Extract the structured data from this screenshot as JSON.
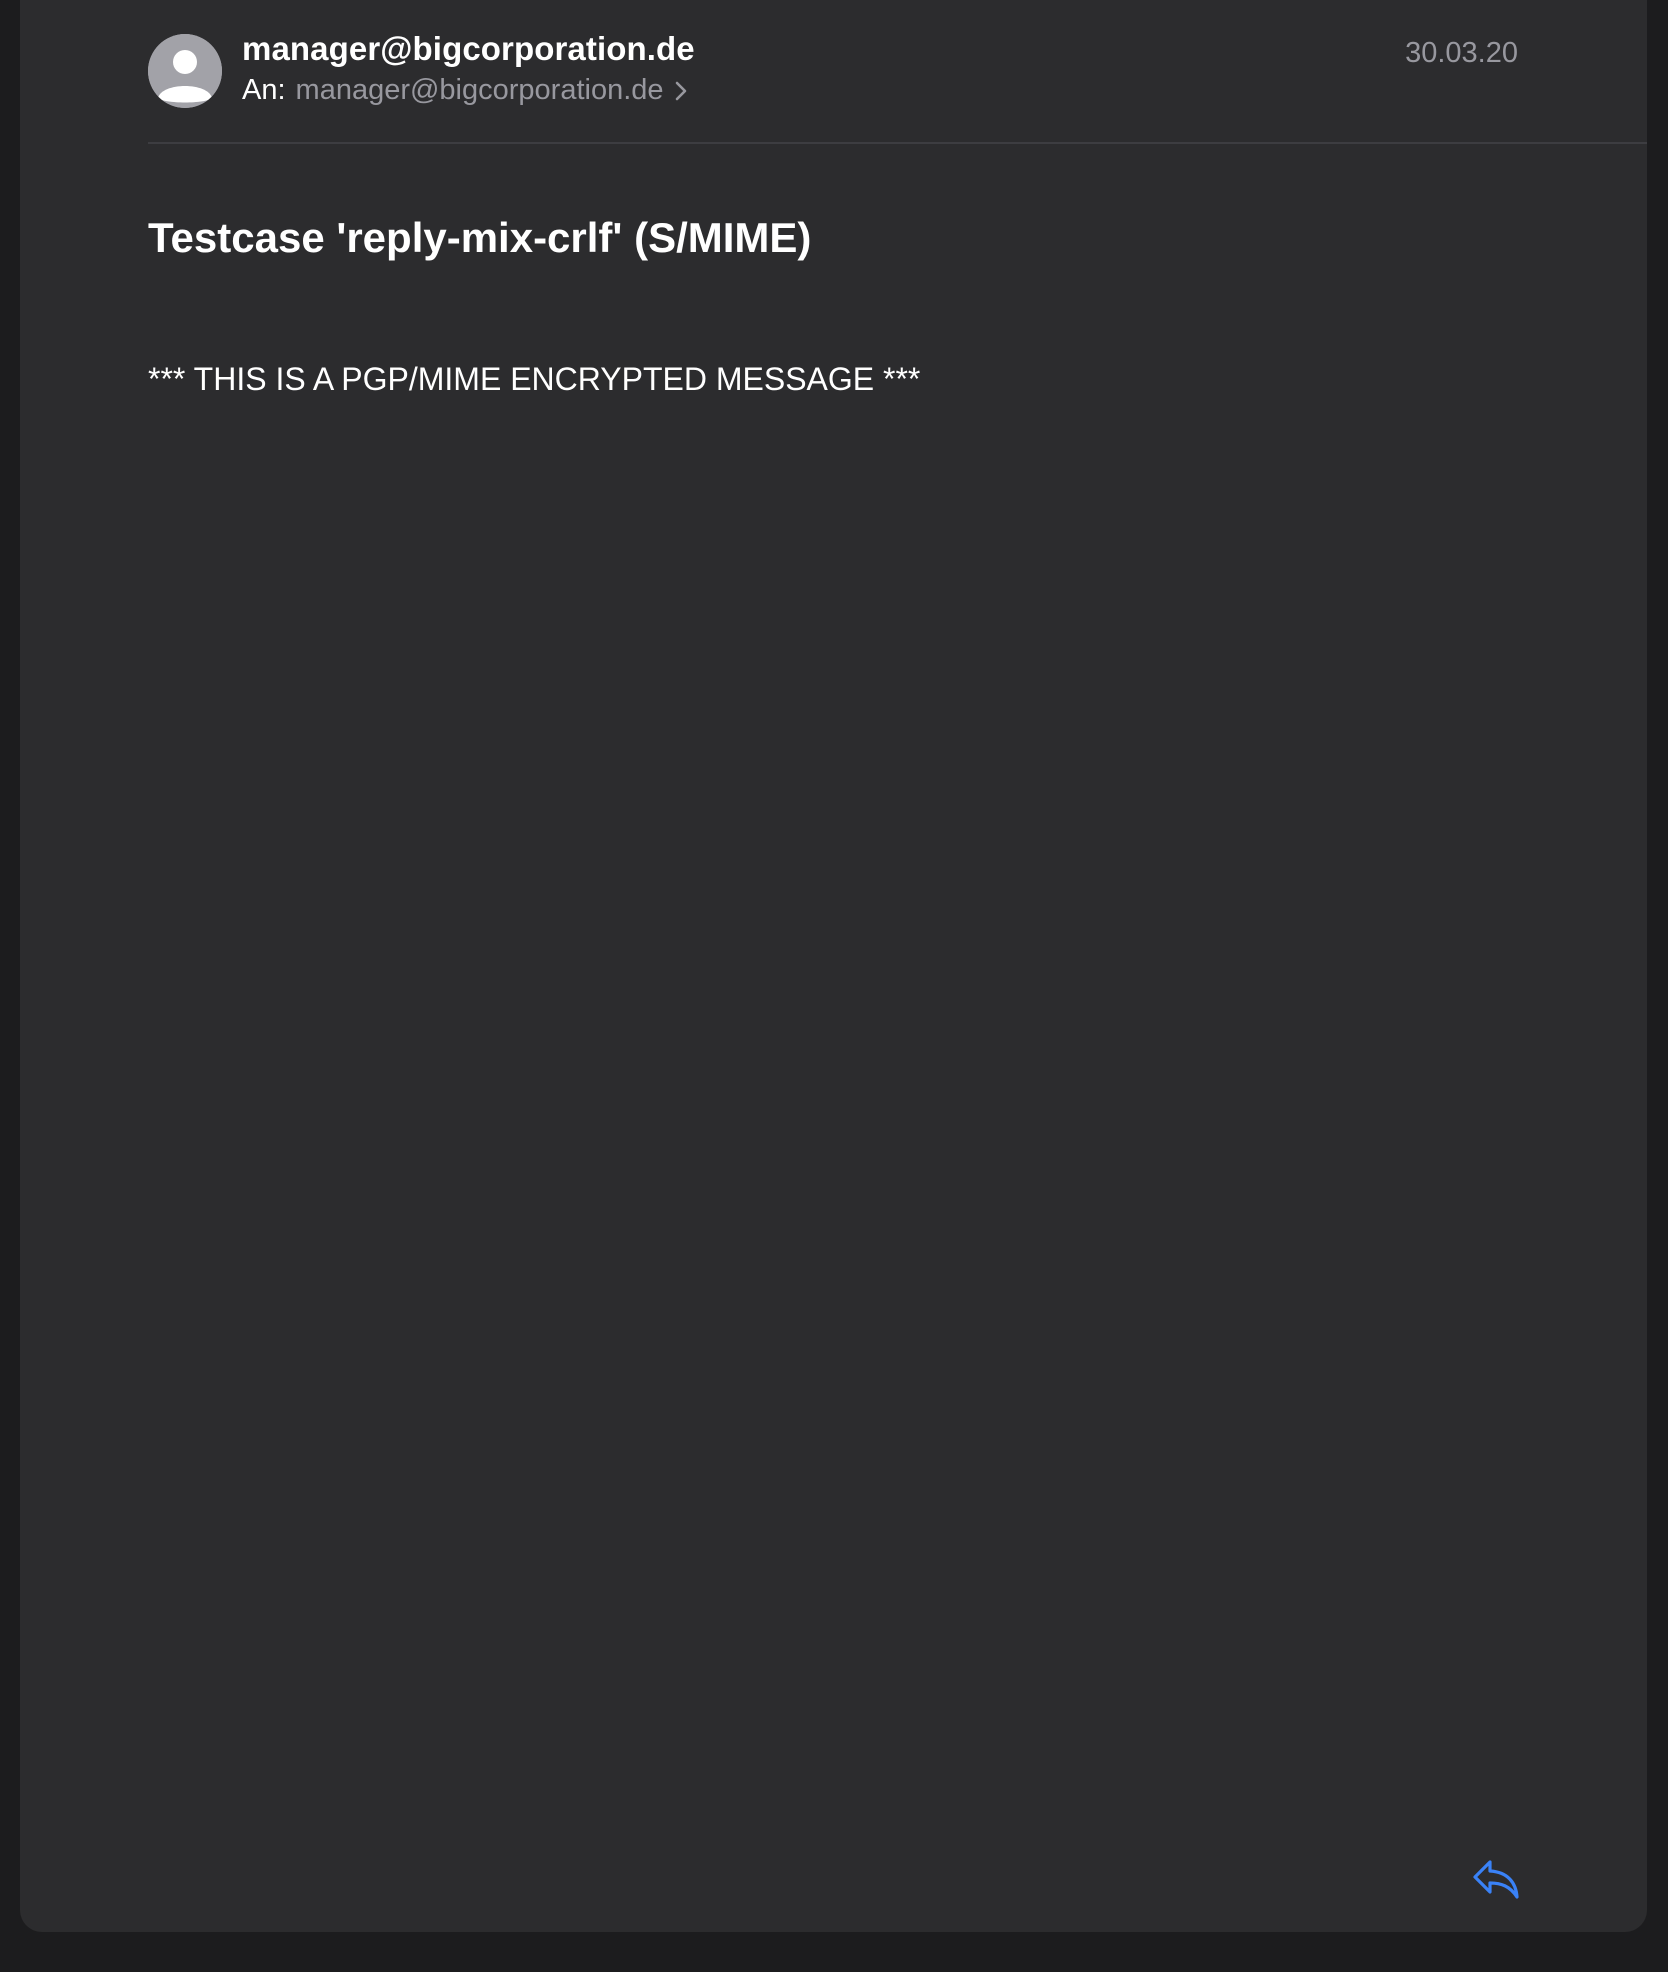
{
  "message": {
    "sender": "manager@bigcorporation.de",
    "recipient_prefix": "An:",
    "recipient": "manager@bigcorporation.de",
    "date": "30.03.20",
    "subject": "Testcase 'reply-mix-crlf' (S/MIME)",
    "body": "*** THIS IS A PGP/MIME ENCRYPTED MESSAGE ***"
  },
  "icons": {
    "avatar": "person-avatar-icon",
    "recipient_disclosure": "chevron-right-icon",
    "reply": "reply-arrow-icon"
  },
  "colors": {
    "background": "#1c1c1e",
    "card": "#2c2c2e",
    "primary_text": "#ffffff",
    "secondary_text": "#98989f",
    "accent": "#3a82f7"
  }
}
